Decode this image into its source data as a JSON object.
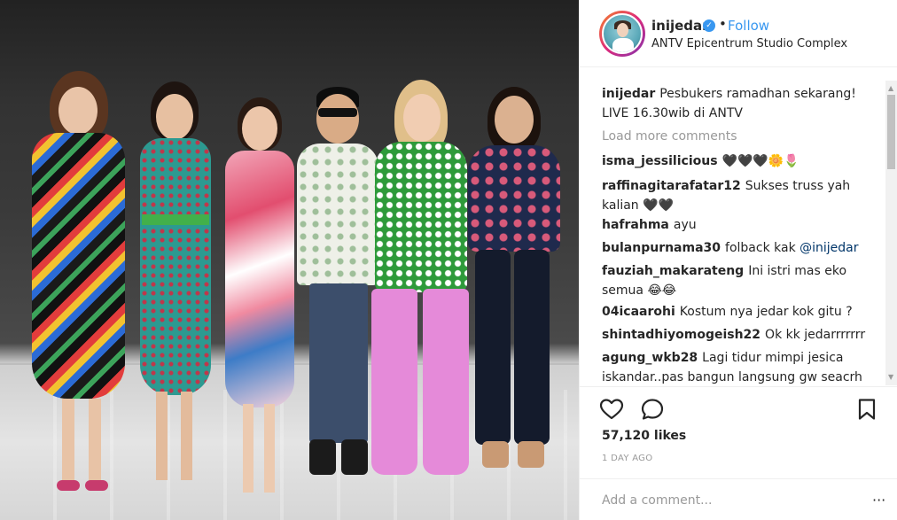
{
  "post": {
    "photo_alt": "",
    "header": {
      "username": "inijedar",
      "verified_icon": "verified-badge-icon",
      "dot": "•",
      "follow_label": "Follow",
      "location": "ANTV Epicentrum Studio Complex"
    },
    "caption": {
      "username": "inijedar",
      "text": "Pesbukers ramadhan sekarang! LIVE 16.30wib di ANTV"
    },
    "load_more": "Load more comments",
    "comments": [
      {
        "username": "isma_jessilicious",
        "text": "🖤🖤🖤🌼🌷"
      },
      {
        "username": "raffinagitarafatar12",
        "text": "Sukses truss yah kalian 🖤🖤"
      },
      {
        "username": "hafrahma",
        "text": "ayu"
      },
      {
        "username": "bulanpurnama30",
        "text": "folback kak",
        "mention": "@inijedar"
      },
      {
        "username": "fauziah_makarateng",
        "text": "Ini istri mas eko semua 😂😂"
      },
      {
        "username": "04icaarohi",
        "text": "Kostum nya jedar kok gitu ?"
      },
      {
        "username": "shintadhiyomogeish22",
        "text": "Ok kk jedarrrrrrr"
      },
      {
        "username": "agung_wkb28",
        "text": "Lagi tidur mimpi jesica iskandar..pas bangun langsung gw seacrh"
      }
    ],
    "likes": "57,120 likes",
    "time": "1 DAY AGO",
    "comment_placeholder": "Add a comment...",
    "more_label": "···",
    "icons": {
      "like": "heart-icon",
      "comment": "comment-bubble-icon",
      "save": "bookmark-icon"
    },
    "colors": {
      "accent": "#3897f0",
      "text": "#262626",
      "muted": "#999999"
    }
  }
}
